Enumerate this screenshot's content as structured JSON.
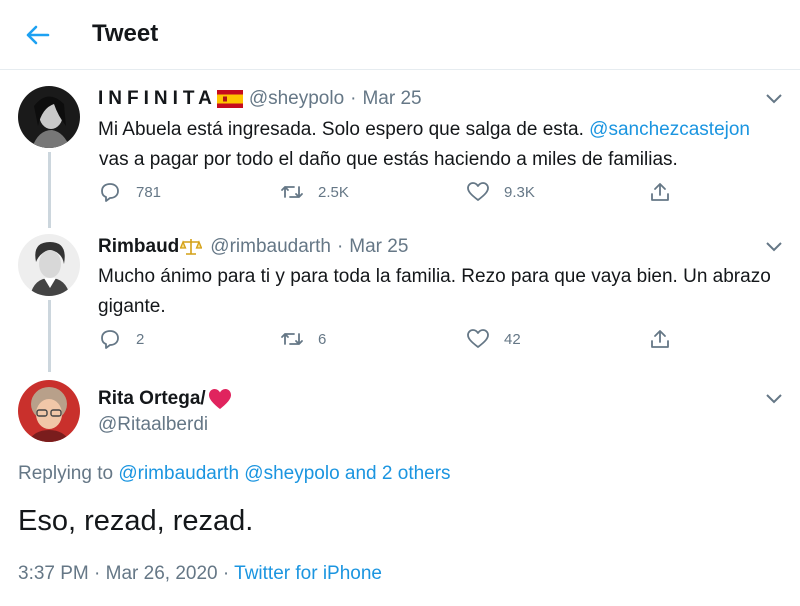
{
  "header": {
    "title": "Tweet",
    "back_icon": "arrow-left-icon",
    "accent": "#1da1f2"
  },
  "thread": [
    {
      "name": "INFINITA",
      "handle": "@sheypolo",
      "date": "Mar 25",
      "text_parts": [
        "Mi Abuela está ingresada. Solo espero que salga de esta. ",
        "@sanchezcastejon",
        "vas a pagar por todo el daño que estás haciendo a miles de familias."
      ],
      "replies": "781",
      "retweets": "2.5K",
      "likes": "9.3K"
    },
    {
      "name": "Rimbaud",
      "handle": "@rimbaudarth",
      "date": "Mar 25",
      "text": "Mucho ánimo para ti y para toda la familia. Rezo para que vaya bien. Un abrazo gigante.",
      "replies": "2",
      "retweets": "6",
      "likes": "42"
    }
  ],
  "main_tweet": {
    "name": "Rita Ortega/",
    "handle": "@Ritaalberdi",
    "replying_prefix": "Replying to ",
    "replying_to_1": "@rimbaudarth",
    "replying_to_2": "@sheypolo",
    "replying_and": " and ",
    "replying_others": "2 others",
    "text": "Eso, rezad, rezad.",
    "time_date": "3:37 PM · Mar 26, 2020 · ",
    "source": "Twitter for iPhone"
  },
  "separator": "·",
  "colors": {
    "link": "#1b95e0",
    "muted": "#657786",
    "heart": "#e0245e"
  }
}
